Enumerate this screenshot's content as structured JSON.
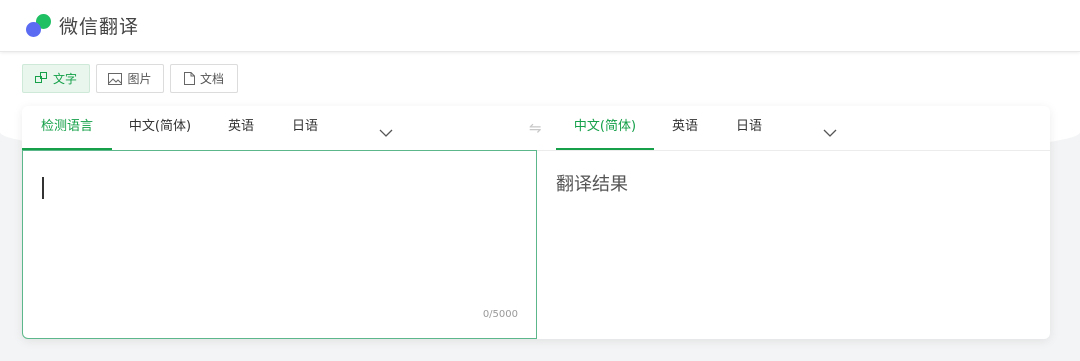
{
  "app": {
    "title": "微信翻译"
  },
  "modes": [
    {
      "label": "文字",
      "icon": "text-translate-icon",
      "active": true
    },
    {
      "label": "图片",
      "icon": "image-icon",
      "active": false
    },
    {
      "label": "文档",
      "icon": "document-icon",
      "active": false
    }
  ],
  "source": {
    "tabs": [
      {
        "label": "检测语言",
        "active": true
      },
      {
        "label": "中文(简体)",
        "active": false
      },
      {
        "label": "英语",
        "active": false
      },
      {
        "label": "日语",
        "active": false
      }
    ],
    "text": "",
    "counter": "0/5000"
  },
  "target": {
    "tabs": [
      {
        "label": "中文(简体)",
        "active": true
      },
      {
        "label": "英语",
        "active": false
      },
      {
        "label": "日语",
        "active": false
      }
    ],
    "placeholder": "翻译结果"
  },
  "icons": {
    "swap": "swap-icon",
    "more": "chevron-down-icon"
  },
  "colors": {
    "accent": "#15a049",
    "logo_green": "#1fbf63",
    "logo_blue": "#5b6cf3"
  }
}
